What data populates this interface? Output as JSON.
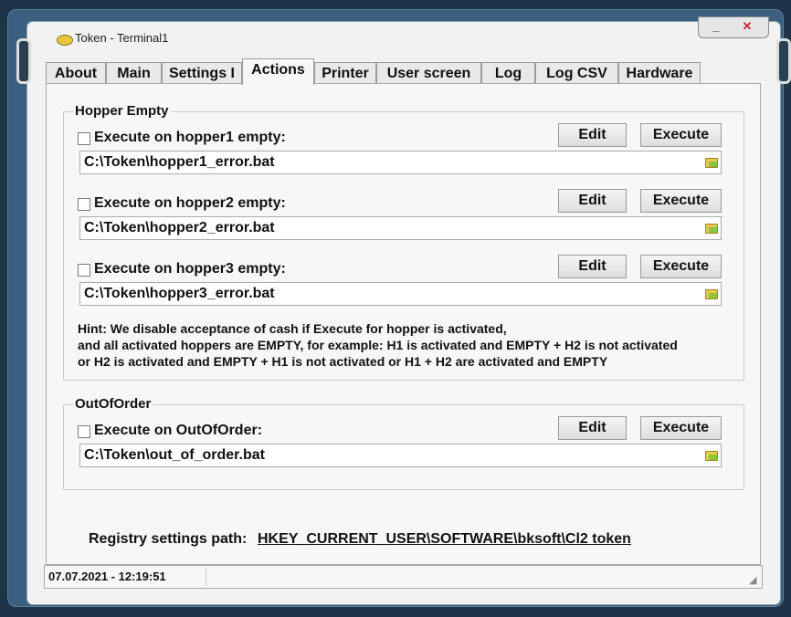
{
  "window": {
    "title": "Token - Terminal1",
    "minimize_label": "_",
    "close_label": "✕"
  },
  "tabs": [
    {
      "label": "About"
    },
    {
      "label": "Main"
    },
    {
      "label": "Settings I"
    },
    {
      "label": "Actions",
      "active": true
    },
    {
      "label": "Printer"
    },
    {
      "label": "User screen"
    },
    {
      "label": "Log"
    },
    {
      "label": "Log CSV"
    },
    {
      "label": "Hardware"
    }
  ],
  "hopper_empty": {
    "title": "Hopper Empty",
    "rows": [
      {
        "label": "Execute on hopper1 empty:",
        "checked": false,
        "edit": "Edit",
        "execute": "Execute",
        "path": "C:\\Token\\hopper1_error.bat"
      },
      {
        "label": "Execute on hopper2 empty:",
        "checked": false,
        "edit": "Edit",
        "execute": "Execute",
        "path": "C:\\Token\\hopper2_error.bat"
      },
      {
        "label": "Execute on hopper3 empty:",
        "checked": false,
        "edit": "Edit",
        "execute": "Execute",
        "path": "C:\\Token\\hopper3_error.bat"
      }
    ],
    "hint_lines": [
      "Hint: We disable acceptance of cash if Execute for hopper is activated,",
      "and all activated hoppers are EMPTY, for example: H1 is activated and EMPTY + H2 is not activated",
      "or H2 is activated and EMPTY + H1 is not activated or H1 + H2 are activated and EMPTY"
    ]
  },
  "out_of_order": {
    "title": "OutOfOrder",
    "label": "Execute on OutOfOrder:",
    "checked": false,
    "edit": "Edit",
    "execute": "Execute",
    "path": "C:\\Token\\out_of_order.bat"
  },
  "registry": {
    "label": "Registry settings path:",
    "path": "HKEY_CURRENT_USER\\SOFTWARE\\bksoft\\Cl2 token"
  },
  "status": {
    "datetime": "07.07.2021 - 12:19:51"
  },
  "icons": {
    "app": "coin-icon",
    "folder": "folder-open-icon"
  },
  "colors": {
    "frame": "#3d5f7f",
    "background": "#1f3346",
    "panel": "#f7f7f7"
  }
}
